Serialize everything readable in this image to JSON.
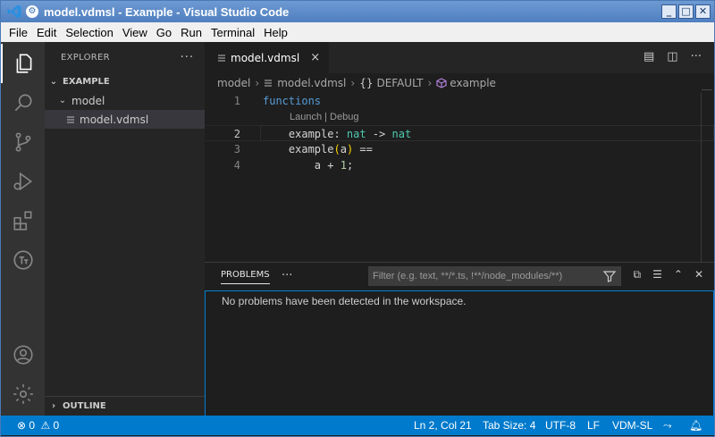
{
  "window": {
    "title": "model.vdmsl - Example - Visual Studio Code",
    "buttons": [
      "_",
      "□",
      "✕"
    ]
  },
  "menu": [
    "File",
    "Edit",
    "Selection",
    "View",
    "Go",
    "Run",
    "Terminal",
    "Help"
  ],
  "activity_bar": [
    "explorer-icon",
    "search-icon",
    "source-control-icon",
    "run-debug-icon",
    "extensions-icon",
    "vdm-icon",
    "account-icon",
    "manage-gear-icon"
  ],
  "sidebar": {
    "header": "EXPLORER",
    "more": "···",
    "workspace": "EXAMPLE",
    "folder": "model",
    "file": "model.vdmsl",
    "outline": "OUTLINE"
  },
  "editor": {
    "tab_label": "model.vdmsl",
    "tab_close": "×",
    "breadcrumb": {
      "folder": "model",
      "file": "model.vdmsl",
      "module": "DEFAULT",
      "symbol": "example"
    },
    "code_lens": "Launch | Debug",
    "lines": [
      {
        "num": "1",
        "text": "functions"
      },
      {
        "num": "2",
        "text": "example: nat -> nat"
      },
      {
        "num": "3",
        "text": "example(a) =="
      },
      {
        "num": "4",
        "text": "a + 1;"
      }
    ],
    "current_line": 2
  },
  "panel": {
    "tab": "PROBLEMS",
    "more": "···",
    "filter_placeholder": "Filter (e.g. text, **/*.ts, !**/node_modules/**)",
    "message": "No problems have been detected in the workspace."
  },
  "status_bar": {
    "errors": "0",
    "warnings": "0",
    "position": "Ln 2, Col 21",
    "tab_size": "Tab Size: 4",
    "encoding": "UTF-8",
    "eol": "LF",
    "language": "VDM-SL"
  },
  "colors": {
    "accent": "#007acc",
    "keyword": "#569cd6",
    "type": "#4ec9b0",
    "number": "#b5cea8"
  }
}
